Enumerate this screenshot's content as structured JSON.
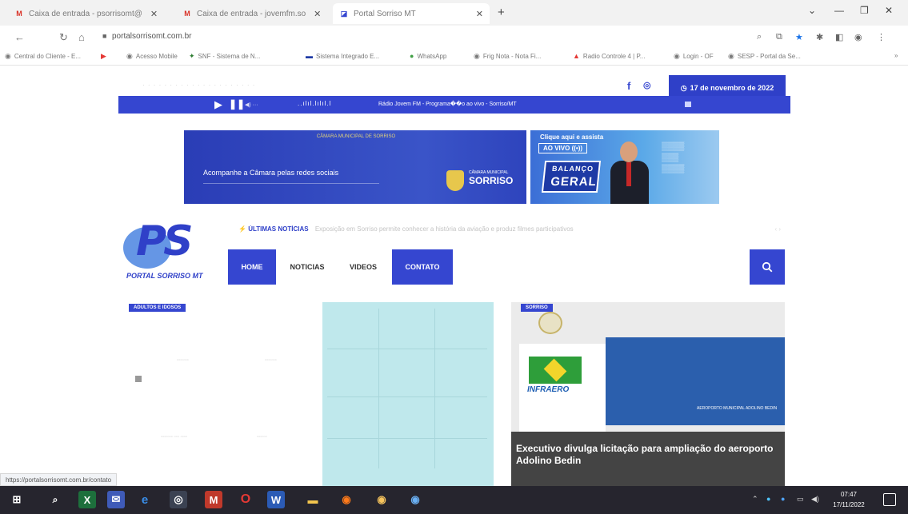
{
  "browser": {
    "tabs": [
      {
        "title": "Caixa de entrada - psorrisomt@",
        "icon": "gmail-icon",
        "active": false
      },
      {
        "title": "Caixa de entrada - jovemfm.so",
        "icon": "gmail-icon",
        "active": false
      },
      {
        "title": "Portal Sorriso MT",
        "icon": "portal-icon",
        "active": true
      }
    ],
    "url": "portalsorrisomt.com.br",
    "bookmarks": [
      "Central do Cliente - E...",
      "",
      "Acesso Mobile",
      "SNF - Sistema de N...",
      "Sistema Integrado E...",
      "WhatsApp",
      "Frig Nota - Nota Fi...",
      "Radio Controle 4 | P...",
      "Login - OF",
      "SESP - Portal da Se..."
    ]
  },
  "site": {
    "date": "17 de novembro de 2022",
    "radio": {
      "wave": "..ılıl.lılıl.l",
      "station": "Rádio Jovem FM - Programa��o ao vivo - Sorriso/MT"
    },
    "ads": {
      "camara_head": "CÂMARA MUNICIPAL DE SORRISO",
      "camara_sub": "Acompanhe a Câmara pelas redes sociais",
      "camara_brand_small": "CÂMARA MUNICIPAL",
      "camara_brand_big": "SORRISO",
      "balanco_cta": "Clique aqui e assista",
      "balanco_live": "AO VIVO ((•))",
      "balanco_l1": "BALANÇO",
      "balanco_l2": "GERAL"
    },
    "logo_name": "PORTAL SORRISO MT",
    "logo_letters": "PS",
    "ticker": {
      "label": "ÚLTIMAS NOTÍCIAS",
      "text": "Exposição em Sorriso permite conhecer a história da aviação e produz filmes participativos"
    },
    "nav": [
      "HOME",
      "NOTICIAS",
      "VIDEOS",
      "CONTATO"
    ],
    "cards": {
      "left_tag": "ADULTOS E IDOSOS",
      "right_tag": "SORRISO",
      "right_headline": "Executivo divulga licitação para ampliação do aeroporto Adolino Bedin",
      "infra_label": "INFRAERO",
      "sign_text": "AEROPORTO MUNICIPAL ADOLINO BEDIN"
    }
  },
  "status_link": "https://portalsorrisomt.com.br/contato",
  "taskbar": {
    "time": "07:47",
    "date": "17/11/2022"
  }
}
